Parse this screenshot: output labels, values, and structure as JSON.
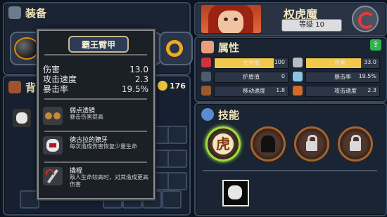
{
  "equipment": {
    "title": "装备",
    "storage_title": "背",
    "gold": "176",
    "item_slots": [
      "bomb-gear",
      "chest-armor",
      "gauntlet",
      "golden-ring"
    ]
  },
  "tooltip": {
    "title": "霸王臂甲",
    "stats": [
      {
        "label": "伤害",
        "value": "13.0"
      },
      {
        "label": "攻击速度",
        "value": "2.3"
      },
      {
        "label": "暴击率",
        "value": "19.5%"
      }
    ],
    "abilities": [
      {
        "name": "弱点透镜",
        "desc": "暴击伤害提高",
        "icon": "goggles-icon"
      },
      {
        "name": "德古拉的獠牙",
        "desc": "每次造成伤害恢复少量生命",
        "icon": "fangs-icon"
      },
      {
        "name": "撬棍",
        "desc": "敌人生命较高时，对其造成更高伤害",
        "icon": "crowbar-icon"
      }
    ]
  },
  "character": {
    "name": "权虎魔",
    "level_label": "等级",
    "level": "10"
  },
  "attributes": {
    "title": "属性",
    "items": [
      {
        "label": "生命值",
        "value": "100",
        "color": "#f2c94c",
        "fill": 0.8
      },
      {
        "label": "伤害",
        "value": "33.0",
        "color": "#f2c94c",
        "fill": 0.75
      },
      {
        "label": "护盾值",
        "value": "0",
        "color": "#39445a",
        "fill": 0
      },
      {
        "label": "暴击率",
        "value": "19.5%",
        "color": "#39445a",
        "fill": 0
      },
      {
        "label": "移动速度",
        "value": "1.8",
        "color": "#39445a",
        "fill": 0
      },
      {
        "label": "攻击速度",
        "value": "2.3",
        "color": "#39445a",
        "fill": 0
      }
    ]
  },
  "skills": {
    "title": "技能",
    "selected_glyph": "虎"
  }
}
